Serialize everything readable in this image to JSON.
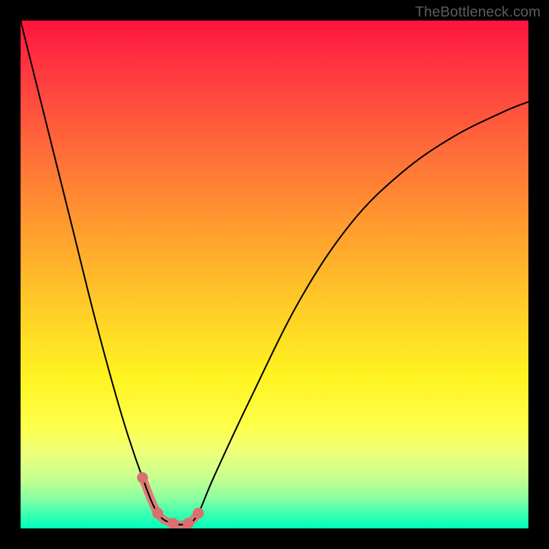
{
  "watermark": "TheBottleneck.com",
  "chart_data": {
    "type": "line",
    "title": "",
    "xlabel": "",
    "ylabel": "",
    "xlim": [
      0,
      100
    ],
    "ylim": [
      0,
      100
    ],
    "grid": false,
    "legend": false,
    "series": [
      {
        "name": "curve",
        "x": [
          0,
          5,
          10,
          15,
          20,
          24,
          27,
          30,
          33,
          35,
          38,
          45,
          55,
          65,
          75,
          85,
          95,
          100
        ],
        "values": [
          100,
          80,
          60,
          40,
          22,
          10,
          3,
          1,
          1,
          3,
          10,
          25,
          45,
          60,
          70,
          77,
          82,
          84
        ]
      }
    ],
    "highlight": {
      "x": [
        24,
        27,
        30,
        33,
        35
      ],
      "values": [
        10,
        3,
        1,
        1,
        3
      ]
    },
    "gradient_stops": [
      {
        "pos": 0,
        "color": "#ff153f"
      },
      {
        "pos": 10,
        "color": "#ff3840"
      },
      {
        "pos": 25,
        "color": "#ff6a3a"
      },
      {
        "pos": 40,
        "color": "#ff9a2f"
      },
      {
        "pos": 55,
        "color": "#ffc828"
      },
      {
        "pos": 70,
        "color": "#fff321"
      },
      {
        "pos": 85,
        "color": "#edff7a"
      },
      {
        "pos": 94,
        "color": "#8cffa0"
      },
      {
        "pos": 100,
        "color": "#00ffbb"
      }
    ]
  }
}
